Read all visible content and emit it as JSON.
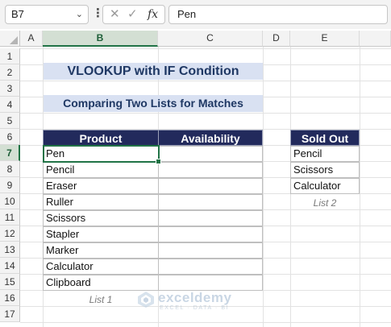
{
  "formula_bar": {
    "name_box": "B7",
    "cancel_glyph": "✕",
    "enter_glyph": "✓",
    "fx_label": "fx",
    "formula_value": "Pen"
  },
  "columns": [
    "A",
    "B",
    "C",
    "D",
    "E"
  ],
  "selected_column": "B",
  "rows": [
    "1",
    "2",
    "3",
    "4",
    "5",
    "6",
    "7",
    "8",
    "9",
    "10",
    "11",
    "12",
    "13",
    "14",
    "15",
    "16",
    "17"
  ],
  "selected_row": "7",
  "title": "VLOOKUP with IF Condition",
  "subtitle": "Comparing Two Lists for Matches",
  "list1": {
    "headers": [
      "Product",
      "Availability"
    ],
    "products": [
      "Pen",
      "Pencil",
      "Eraser",
      "Ruller",
      "Scissors",
      "Stapler",
      "Marker",
      "Calculator",
      "Clipboard"
    ],
    "availability": [
      "",
      "",
      "",
      "",
      "",
      "",
      "",
      "",
      ""
    ],
    "caption": "List 1"
  },
  "list2": {
    "header": "Sold Out",
    "items": [
      "Pencil",
      "Scissors",
      "Calculator"
    ],
    "caption": "List 2"
  },
  "watermark": {
    "name": "exceldemy",
    "tagline": "EXCEL · DATA · BI"
  },
  "colors": {
    "header_fill": "#222a5c",
    "title_fill": "#d9e1f2",
    "title_text": "#1f3864",
    "selection": "#217346"
  }
}
